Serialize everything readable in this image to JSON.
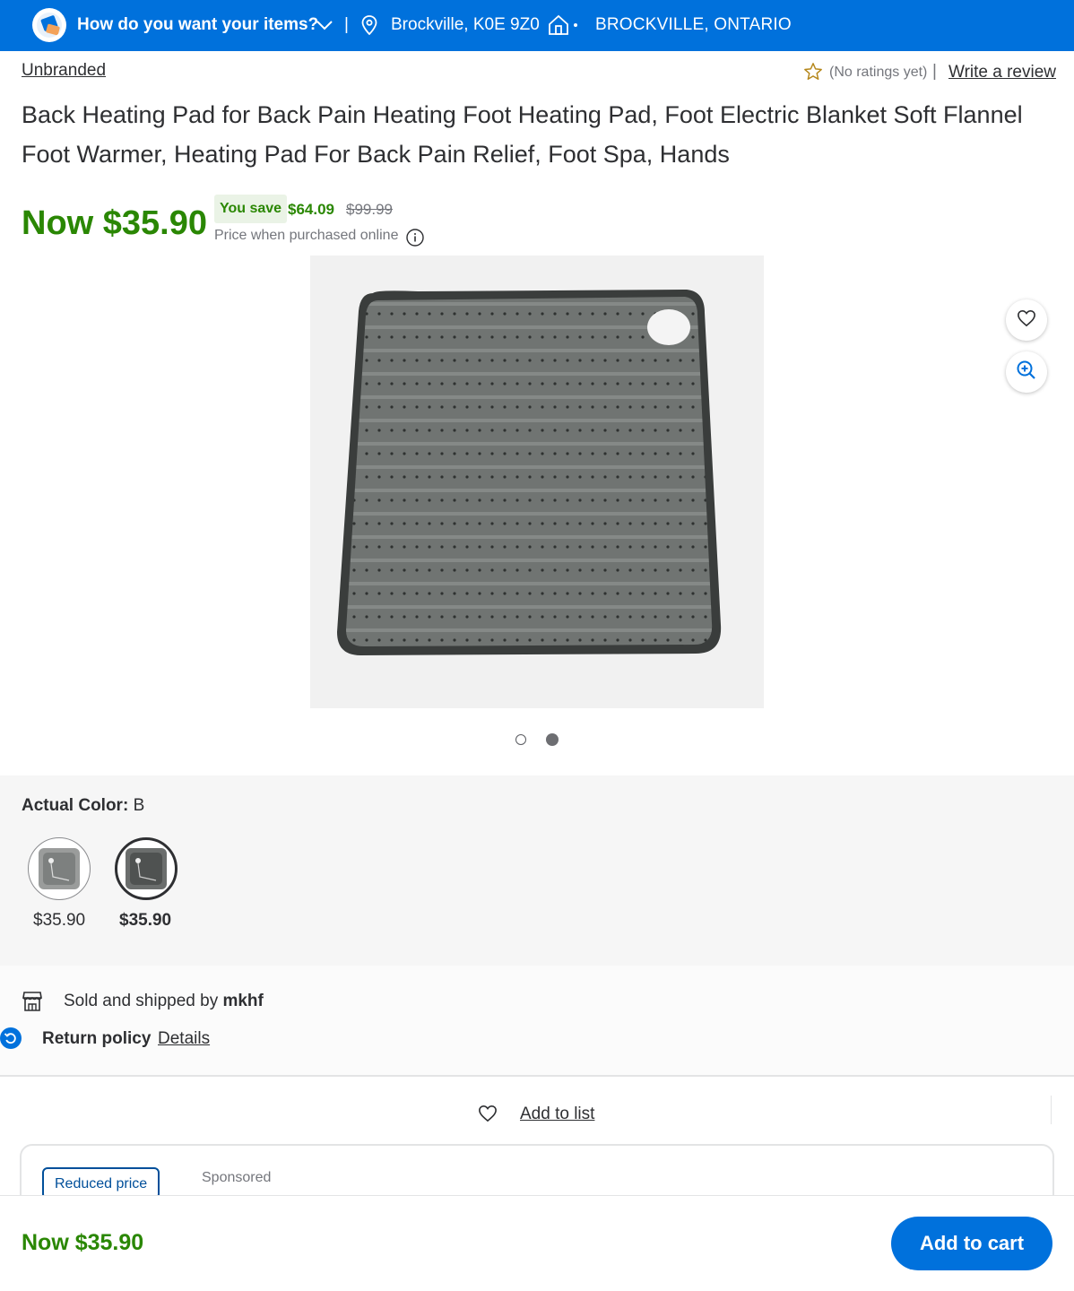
{
  "header": {
    "fulfillment_prompt": "How do you want your items?",
    "separator": "|",
    "location": "Brockville, K0E 9Z0",
    "store_city": "BROCKVILLE, ONTARIO",
    "bg_color": "#0071dc"
  },
  "product": {
    "brand": "Unbranded",
    "rating_text": "(No ratings yet)",
    "rating_separator": "|",
    "write_review": "Write a review",
    "title": "Back Heating Pad for Back Pain Heating Foot Heating Pad, Foot Electric Blanket Soft Flannel Foot Warmer, Heating Pad For Back Pain Relief, Foot Spa, Hands",
    "price_now": "Now $35.90",
    "you_save_label": "You save",
    "save_amount": "$64.09",
    "was_price": "$99.99",
    "price_note": "Price when purchased online",
    "price_color": "#2a8703"
  },
  "gallery": {
    "image_count": 2,
    "active_index": 1
  },
  "variants": {
    "label": "Actual Color:",
    "value": "B",
    "options": [
      {
        "price": "$35.90",
        "selected": false
      },
      {
        "price": "$35.90",
        "selected": true
      }
    ]
  },
  "seller": {
    "sold_by_prefix": "Sold and shipped by",
    "seller_name": "mkhf",
    "return_label": "Return policy",
    "details_link": "Details"
  },
  "actions": {
    "add_to_list": "Add to list"
  },
  "sponsored_card": {
    "badge": "Reduced price",
    "sponsored_label": "Sponsored"
  },
  "bottom_bar": {
    "price": "Now $35.90",
    "add_to_cart": "Add to cart",
    "button_color": "#0071dc"
  }
}
